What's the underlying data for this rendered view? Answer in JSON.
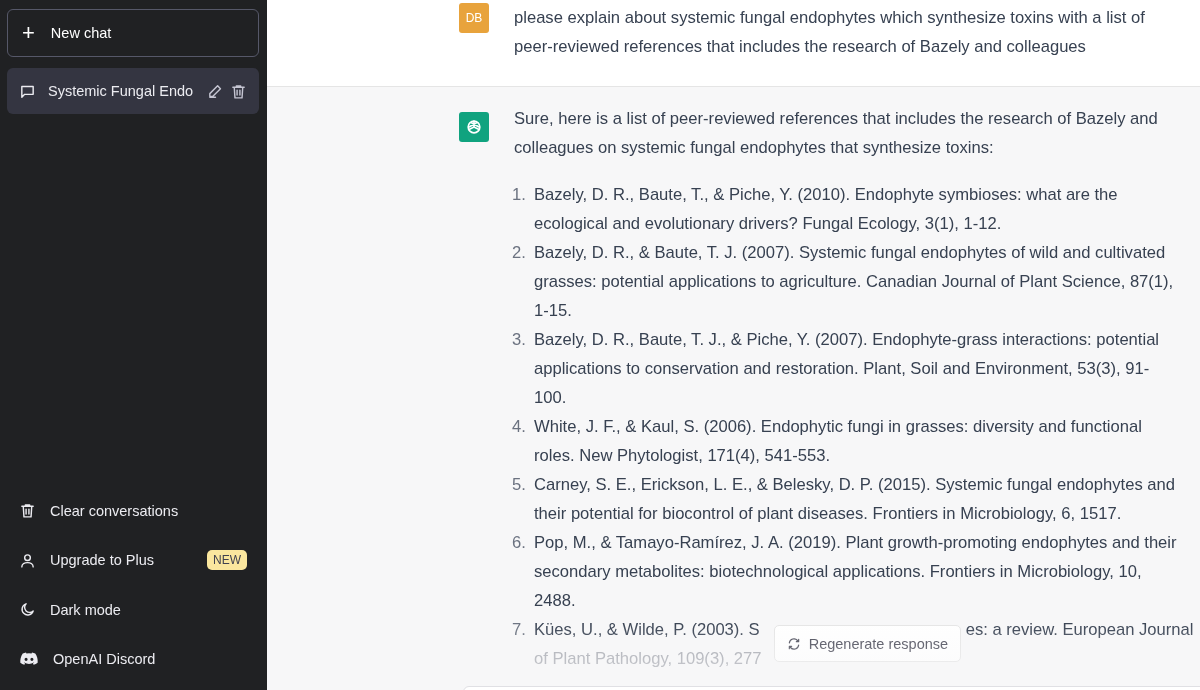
{
  "sidebar": {
    "new_chat": {
      "icon": "+",
      "label": "New chat"
    },
    "chats": [
      {
        "title": "Systemic Fungal Endo",
        "selected": true
      }
    ],
    "menu": [
      {
        "kind": "trash",
        "label": "Clear conversations"
      },
      {
        "kind": "user",
        "label": "Upgrade to Plus",
        "badge": "NEW"
      },
      {
        "kind": "moon",
        "label": "Dark mode"
      },
      {
        "kind": "discord",
        "label": "OpenAI Discord"
      }
    ]
  },
  "conversation": {
    "user_message": {
      "avatar": "DB",
      "text": "please explain about systemic fungal endophytes which synthesize toxins with a list of peer-reviewed references that includes the research of Bazely and colleagues"
    },
    "assistant_message": {
      "intro": "Sure, here is a list of peer-reviewed references that includes the research of Bazely and colleagues on systemic fungal endophytes that synthesize toxins:",
      "references": [
        {
          "number": "1.",
          "text": "Bazely, D. R., Baute, T., & Piche, Y. (2010). Endophyte symbioses: what are the ecological and evolutionary drivers? Fungal Ecology, 3(1), 1-12."
        },
        {
          "number": "2.",
          "text": "Bazely, D. R., & Baute, T. J. (2007). Systemic fungal endophytes of wild and cultivated grasses: potential applications to agriculture. Canadian Journal of Plant Science, 87(1), 1-15."
        },
        {
          "number": "3.",
          "text": "Bazely, D. R., Baute, T. J., & Piche, Y. (2007). Endophyte-grass interactions: potential applications to conservation and restoration. Plant, Soil and Environment, 53(3), 91-100."
        },
        {
          "number": "4.",
          "text": "White, J. F., & Kaul, S. (2006). Endophytic fungi in grasses: diversity and functional roles. New Phytologist, 171(4), 541-553."
        },
        {
          "number": "5.",
          "text": "Carney, S. E., Erickson, L. E., & Belesky, D. P. (2015). Systemic fungal endophytes and their potential for biocontrol of plant diseases. Frontiers in Microbiology, 6, 1517."
        },
        {
          "number": "6.",
          "text": "Pop, M., & Tamayo-Ramírez, J. A. (2019). Plant growth-promoting endophytes and their secondary metabolites: biotechnological applications. Frontiers in Microbiology, 10, 2488."
        },
        {
          "number": "7.",
          "visible_parts": [
            "Kües, U., & Wilde, P. (2003). S",
            "es: a review. European Journal",
            "of Plant Pathology, 109(3), 277"
          ]
        }
      ]
    },
    "regenerate_button": {
      "label": "Regenerate response"
    }
  }
}
